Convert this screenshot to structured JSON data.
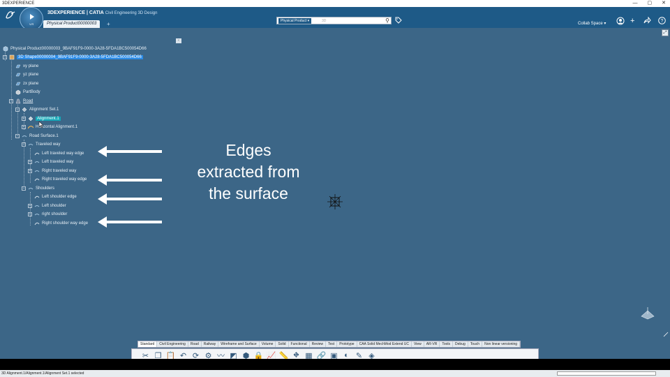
{
  "os": {
    "title": "3DEXPERIENCE",
    "min": "—",
    "max": "▢",
    "close": "✕"
  },
  "header": {
    "brand": "3DEXPERIENCE | CATIA",
    "app": "Civil Engineering 3D Design",
    "compass_version": "V.R",
    "tab_label": "Physical Product00000003",
    "tab_add": "+",
    "search_scope": "Physical Product",
    "search_placeholder": "3D",
    "collab_space": "Collab Space"
  },
  "tree": [
    {
      "label": "Physical Product00000003_9BAF91F9-0000-3A28-5FDA1BC500054D66"
    },
    {
      "label": "3D Shape00000004_9BAF91F9-0000-3A28-5FDA1BC500054D66"
    },
    {
      "label": "xy plane"
    },
    {
      "label": "yz plane"
    },
    {
      "label": "zx plane"
    },
    {
      "label": "PartBody"
    },
    {
      "label": "Road"
    },
    {
      "label": "Alignment Set.1"
    },
    {
      "label": "Alignment.1"
    },
    {
      "label": "Horizontal Alignment.1"
    },
    {
      "label": "Road Surface.1"
    },
    {
      "label": "Traveled way"
    },
    {
      "label": "Left traveled way edge"
    },
    {
      "label": "Left traveled way"
    },
    {
      "label": "Right traveled way"
    },
    {
      "label": "Right traveled way edge"
    },
    {
      "label": "Shoulders"
    },
    {
      "label": "Left shoulder edge"
    },
    {
      "label": "Left shoulder"
    },
    {
      "label": "right shoulder"
    },
    {
      "label": "Right shoulder way edge"
    }
  ],
  "annotation": {
    "line1": "Edges",
    "line2": "extracted from",
    "line3": "the surface"
  },
  "toolbar_tabs": [
    "Standard",
    "Civil Engineering",
    "Road",
    "Railway",
    "Wireframe and Surface",
    "Volume",
    "Solid",
    "Functional",
    "Review",
    "Test",
    "Prototype",
    "CAA Solid MechMod Extend UC",
    "View",
    "AR-VR",
    "Tools",
    "Debug",
    "Touch",
    "Non linear versioning"
  ],
  "toolbar_icons": [
    "cut-icon",
    "copy-icon",
    "paste-icon",
    "undo-icon",
    "redo-icon",
    "update-icon",
    "curve-icon",
    "surface-icon",
    "volume-icon",
    "lock-icon",
    "graph-icon",
    "ruler-icon",
    "road-icon",
    "grid-icon",
    "link-icon",
    "box-icon",
    "sweep-icon",
    "edit-icon",
    "analyze-icon"
  ],
  "status": {
    "text": "3D Alignment.1/Alignment.1/Alignment Set.1 selected"
  },
  "colors": {
    "header": "#1e5a87",
    "viewport": "#3c6687",
    "selection": "#2b8be6",
    "selection_secondary": "#14a8b8"
  }
}
